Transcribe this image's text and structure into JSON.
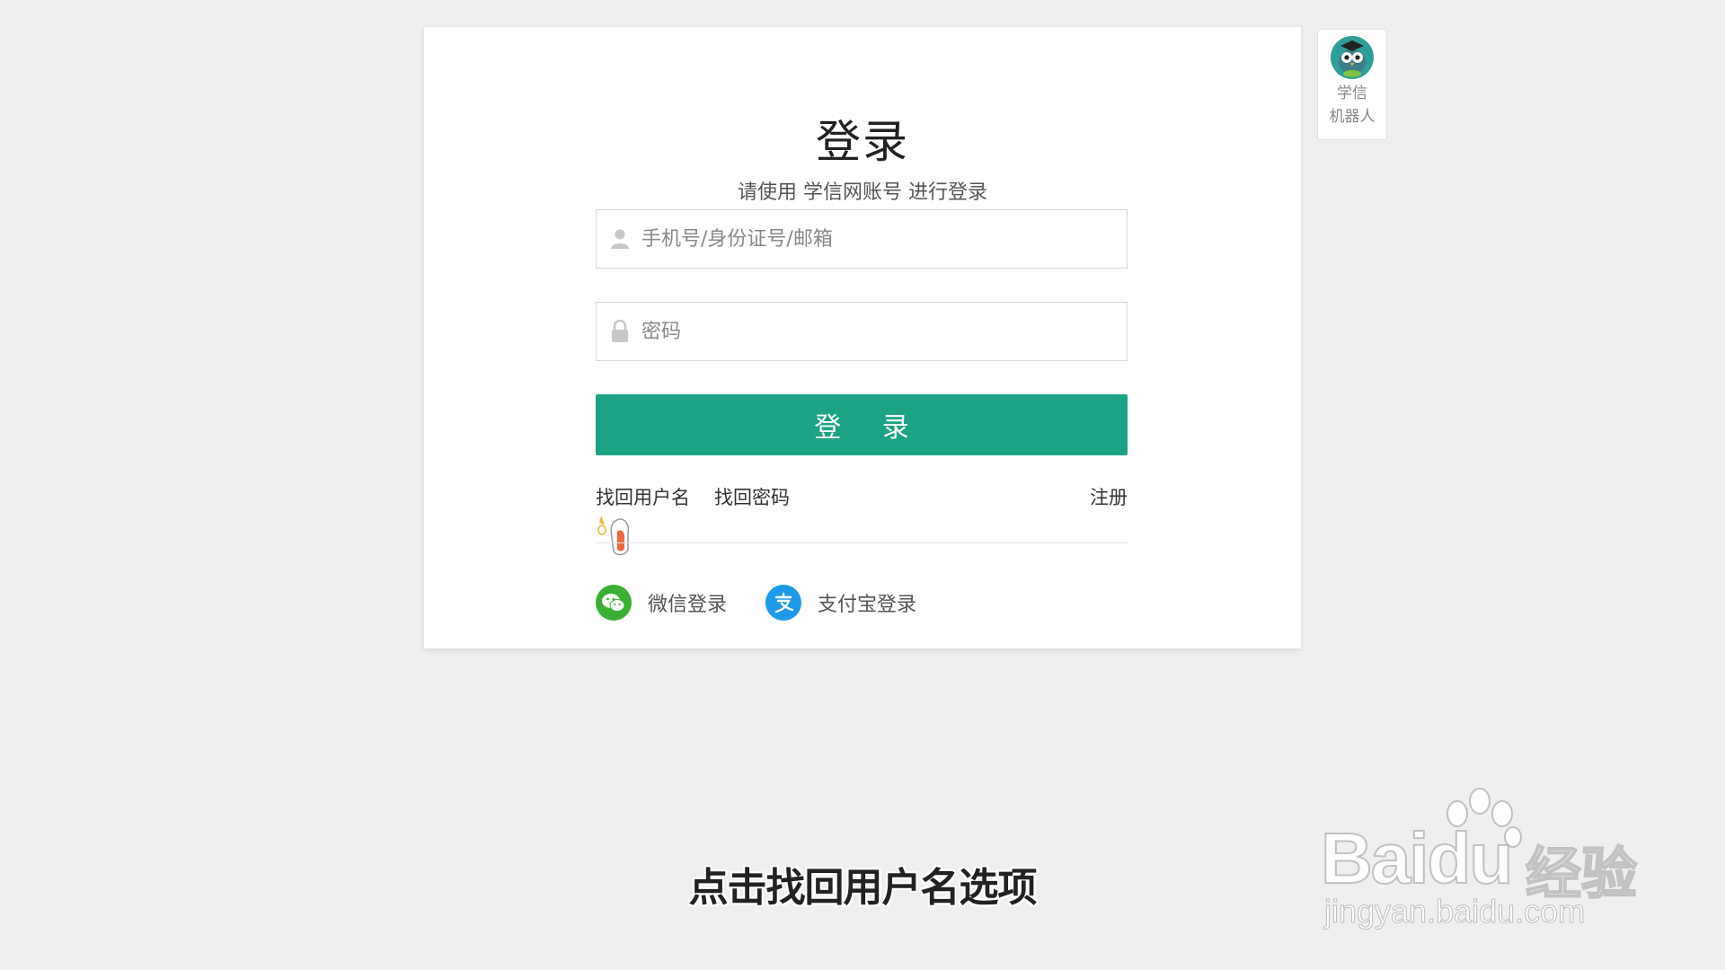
{
  "login": {
    "title": "登录",
    "subtitle": "请使用 学信网账号 进行登录",
    "username_placeholder": "手机号/身份证号/邮箱",
    "password_placeholder": "密码",
    "login_button": "登 录",
    "forgot_username": "找回用户名",
    "forgot_password": "找回密码",
    "register": "注册",
    "wechat_login": "微信登录",
    "alipay_login": "支付宝登录"
  },
  "robot": {
    "line1": "学信",
    "line2": "机器人"
  },
  "caption": "点击找回用户名选项",
  "watermark": {
    "brand": "Bai",
    "brand_du": "du",
    "brand_cn": "经验",
    "url": "jingyan.baidu.com"
  },
  "colors": {
    "primary_button": "#1ca385",
    "wechat": "#3cb034",
    "alipay": "#1d9bea",
    "background": "#eef0f0"
  },
  "icons": [
    "user-icon",
    "lock-icon",
    "wechat-icon",
    "alipay-icon",
    "robot-owl-icon",
    "baidu-paw-icon"
  ]
}
